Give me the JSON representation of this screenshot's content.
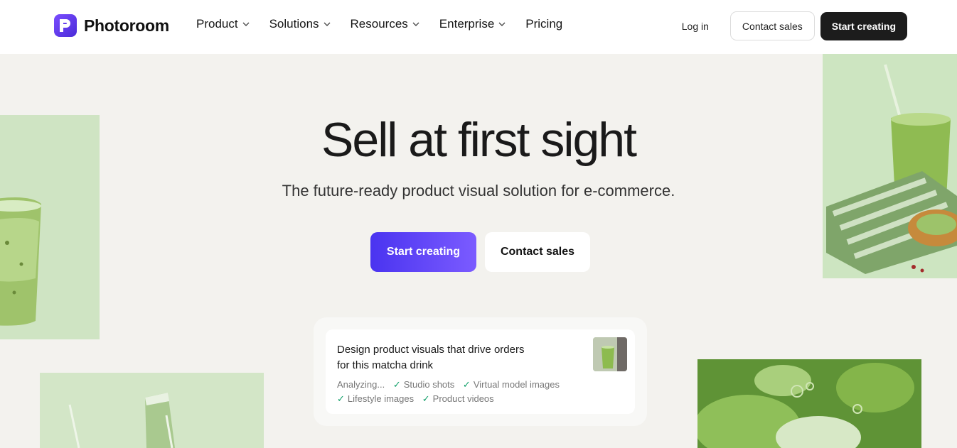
{
  "brand": {
    "name": "Photoroom",
    "accent": "#5b3ff5"
  },
  "nav": {
    "items": [
      {
        "label": "Product",
        "has_dropdown": true
      },
      {
        "label": "Solutions",
        "has_dropdown": true
      },
      {
        "label": "Resources",
        "has_dropdown": true
      },
      {
        "label": "Enterprise",
        "has_dropdown": true
      },
      {
        "label": "Pricing",
        "has_dropdown": false
      }
    ],
    "login": "Log in",
    "contact": "Contact sales",
    "start": "Start creating"
  },
  "hero": {
    "title": "Sell at first sight",
    "subtitle": "The future-ready product visual solution for e-commerce.",
    "cta_primary": "Start creating",
    "cta_secondary": "Contact sales"
  },
  "prompt": {
    "line1": "Design product visuals that drive orders",
    "line2": "for this matcha drink",
    "status": "Analyzing...",
    "tags": [
      "Studio shots",
      "Virtual model images",
      "Lifestyle images",
      "Product videos"
    ]
  }
}
